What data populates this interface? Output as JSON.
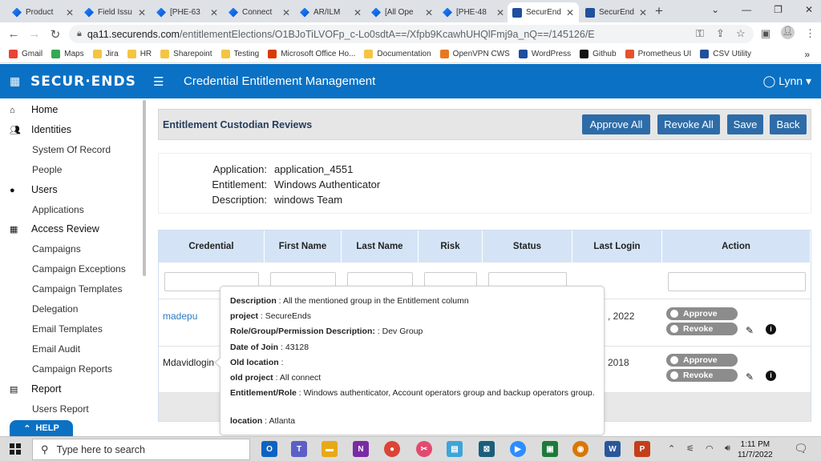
{
  "browser": {
    "tabs": [
      {
        "label": "Product",
        "icon": "jira"
      },
      {
        "label": "Field Issu",
        "icon": "jira"
      },
      {
        "label": "[PHE-63",
        "icon": "jira"
      },
      {
        "label": "Connect",
        "icon": "jira"
      },
      {
        "label": "AR/ILM",
        "icon": "jira"
      },
      {
        "label": "[All Ope",
        "icon": "jira"
      },
      {
        "label": "[PHE-48",
        "icon": "jira"
      },
      {
        "label": "SecurEnd",
        "icon": "secureends",
        "active": true
      },
      {
        "label": "SecurEnd",
        "icon": "secureends"
      }
    ],
    "new_tab": "+",
    "url_host": "qa11.securends.com",
    "url_path": "/entitlementElections/O1BJoTiLVOFp_c-Lo0sdtA==/Xfpb9KcawhUHQlFmj9a_nQ==/145126/E",
    "bookmarks": [
      "Gmail",
      "Maps",
      "Jira",
      "HR",
      "Sharepoint",
      "Testing",
      "Microsoft Office Ho...",
      "Documentation",
      "OpenVPN CWS",
      "WordPress",
      "Github",
      "Prometheus UI",
      "CSV Utility"
    ],
    "more_bookmarks": "»"
  },
  "app": {
    "logo": "SECUR·ENDS",
    "title": "Credential Entitlement Management",
    "user": "Lynn"
  },
  "sidebar": {
    "items": [
      {
        "label": "Home",
        "type": "section",
        "icon": "home-icon"
      },
      {
        "label": "Identities",
        "type": "section",
        "icon": "identities-icon"
      },
      {
        "label": "System Of Record",
        "type": "sub"
      },
      {
        "label": "People",
        "type": "sub"
      },
      {
        "label": "Users",
        "type": "section",
        "icon": "user-icon"
      },
      {
        "label": "Applications",
        "type": "sub"
      },
      {
        "label": "Access Review",
        "type": "section",
        "icon": "grid-icon"
      },
      {
        "label": "Campaigns",
        "type": "sub"
      },
      {
        "label": "Campaign Exceptions",
        "type": "sub"
      },
      {
        "label": "Campaign Templates",
        "type": "sub"
      },
      {
        "label": "Delegation",
        "type": "sub"
      },
      {
        "label": "Email Templates",
        "type": "sub"
      },
      {
        "label": "Email Audit",
        "type": "sub"
      },
      {
        "label": "Campaign Reports",
        "type": "sub"
      },
      {
        "label": "Report",
        "type": "section",
        "icon": "report-icon"
      },
      {
        "label": "Users Report",
        "type": "sub"
      }
    ],
    "help": "HELP"
  },
  "review": {
    "title": "Entitlement Custodian Reviews",
    "buttons": {
      "approve_all": "Approve All",
      "revoke_all": "Revoke All",
      "save": "Save",
      "back": "Back"
    },
    "application_label": "Application:",
    "application": "application_4551",
    "entitlement_label": "Entitlement:",
    "entitlement": "Windows Authenticator",
    "description_label": "Description:",
    "description": "windows Team"
  },
  "table": {
    "columns": [
      "Credential",
      "First Name",
      "Last Name",
      "Risk",
      "Status",
      "Last Login",
      "Action"
    ],
    "rows": [
      {
        "credential": "madepu",
        "last_login": ", 2022",
        "approve": "Approve",
        "revoke": "Revoke"
      },
      {
        "credential": "Mdavidlogin",
        "last_login": "2018",
        "approve": "Approve",
        "revoke": "Revoke"
      }
    ]
  },
  "tooltip": {
    "fields": [
      {
        "label": "Description",
        "value": "All the mentioned group in the Entitlement column"
      },
      {
        "label": "project",
        "value": "SecureEnds"
      },
      {
        "label": "Role/Group/Permission Description: ",
        "value": "Dev Group"
      },
      {
        "label": "Date of Join",
        "value": "43128"
      },
      {
        "label": "Old location",
        "value": ""
      },
      {
        "label": "old project",
        "value": "All connect"
      },
      {
        "label": "Entitlement/Role",
        "value": "Windows authenticator, Account operators group and backup operators group."
      },
      {
        "label": "location",
        "value": "Atlanta"
      }
    ]
  },
  "taskbar": {
    "search_placeholder": "Type here to search",
    "time": "1:11 PM",
    "date": "11/7/2022"
  },
  "colors": {
    "brand": "#0a71c4",
    "button": "#2d6ca8",
    "table_header": "#d4e4f6",
    "link": "#2b7bc6"
  }
}
